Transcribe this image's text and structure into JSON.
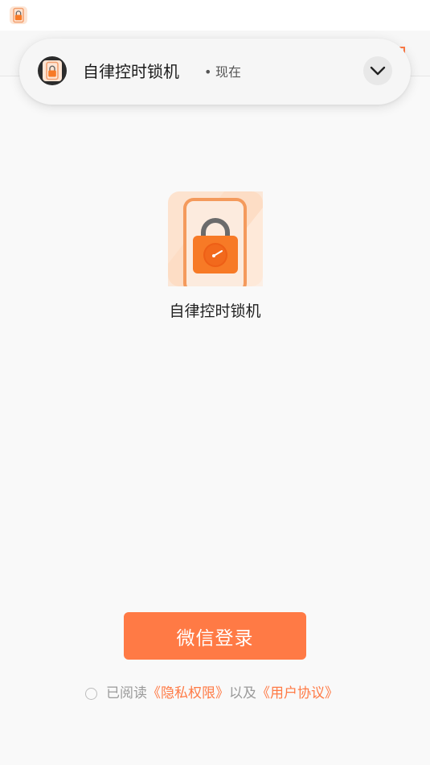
{
  "status_bar": {
    "app_icon": "orange-lock-app-icon"
  },
  "notification": {
    "app_name": "自律控时锁机",
    "separator": "•",
    "time": "现在",
    "expand_icon": "chevron-down-icon"
  },
  "app": {
    "name": "自律控时锁机",
    "logo": "phone-padlock-timer-logo"
  },
  "login": {
    "wechat_label": "微信登录"
  },
  "agreement": {
    "prefix": "已阅读",
    "privacy_link": "《隐私权限》",
    "and": "以及",
    "terms_link": "《用户协议》"
  },
  "colors": {
    "accent": "#ff7a45",
    "background": "#f9f9f9",
    "notification_bg": "#f6f6f6"
  }
}
